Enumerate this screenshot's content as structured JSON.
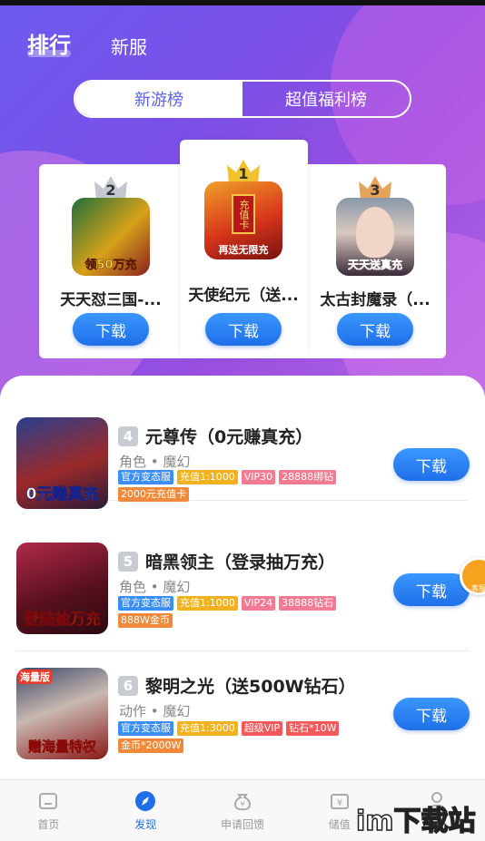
{
  "header": {
    "tabs": [
      {
        "label": "排行",
        "active": true
      },
      {
        "label": "新服",
        "active": false
      }
    ]
  },
  "segment": {
    "options": [
      {
        "label": "新游榜",
        "active": true
      },
      {
        "label": "超值福利榜",
        "active": false
      }
    ]
  },
  "podium": [
    {
      "rank": "2",
      "name": "天天怼三国-...",
      "button": "下载",
      "crown_color": "#c3c7cf",
      "icon_text": "领50万充"
    },
    {
      "rank": "1",
      "name": "天使纪元（送...",
      "button": "下载",
      "crown_color": "#f2c12e",
      "icon_text": "充值卡",
      "icon_text2": "再送无限充"
    },
    {
      "rank": "3",
      "name": "太古封魔录（...",
      "button": "下载",
      "crown_color": "#e6a35b",
      "icon_text": "天天送真充"
    }
  ],
  "list": [
    {
      "rank": "4",
      "name": "元尊传（0元赚真充）",
      "genre": "角色 • 魔幻",
      "tags": [
        {
          "text": "官方变态服",
          "color": "blue"
        },
        {
          "text": "充值1:1000",
          "color": "yellow"
        },
        {
          "text": "VIP30",
          "color": "pink"
        },
        {
          "text": "28888绑钻",
          "color": "pink"
        },
        {
          "text": "2000元充值卡",
          "color": "orange"
        }
      ],
      "icon_text": "0元赚真充",
      "button": "下载"
    },
    {
      "rank": "5",
      "name": "暗黑领主（登录抽万充）",
      "genre": "角色 • 魔幻",
      "tags": [
        {
          "text": "官方变态服",
          "color": "blue"
        },
        {
          "text": "充值1:1000",
          "color": "yellow"
        },
        {
          "text": "VIP24",
          "color": "pink"
        },
        {
          "text": "38888钻石",
          "color": "pink"
        },
        {
          "text": "888W金币",
          "color": "orange"
        }
      ],
      "icon_text": "登陆抽万充",
      "button": "下载"
    },
    {
      "rank": "6",
      "name": "黎明之光（送500W钻石）",
      "genre": "动作 • 魔幻",
      "tags": [
        {
          "text": "官方变态服",
          "color": "blue"
        },
        {
          "text": "充值1:3000",
          "color": "yellow"
        },
        {
          "text": "超级VIP",
          "color": "red"
        },
        {
          "text": "钻石*10W",
          "color": "red"
        },
        {
          "text": "金币*2000W",
          "color": "orange"
        }
      ],
      "icon_text": "赠海量特权",
      "icon_badge": "海量版",
      "button": "下载"
    }
  ],
  "float_badge": {
    "label": "客服"
  },
  "tabbar": [
    {
      "label": "首页",
      "icon": "home-icon",
      "active": false
    },
    {
      "label": "发现",
      "icon": "compass-icon",
      "active": true
    },
    {
      "label": "申请回馈",
      "icon": "money-bag-icon",
      "active": false
    },
    {
      "label": "储值",
      "icon": "yuan-card-icon",
      "active": false
    },
    {
      "label": "",
      "icon": "user-icon",
      "active": false
    }
  ],
  "watermark": "im下载站",
  "colors": {
    "accent": "#1f6fe8",
    "hero_start": "#6d5bf0",
    "hero_end": "#b567e2"
  }
}
